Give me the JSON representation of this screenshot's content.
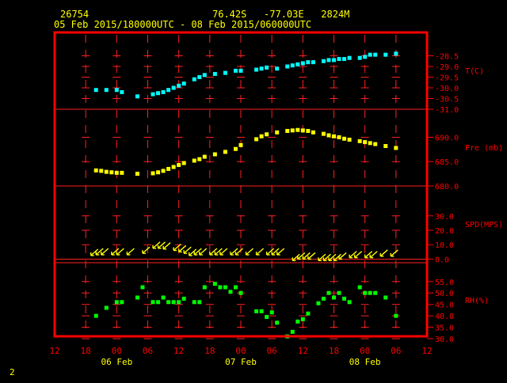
{
  "header": {
    "station": "26754",
    "coords": "76.42S   -77.03E   2824M",
    "period": "05 Feb 2015/180000UTC - 08 Feb 2015/060000UTC"
  },
  "page_number": "2",
  "colors": {
    "background": "#000000",
    "frame": "#ff0000",
    "grid": "#ff2020",
    "text": "#ffff00",
    "temperature": "#00ffff",
    "pressure": "#ffff00",
    "wind": "#ffff00",
    "humidity": "#00ff00"
  },
  "chart_data": {
    "type": "scatter",
    "x_unit": "hours since 05 Feb 2015 12 UTC",
    "x_ticks": [
      {
        "x": 0,
        "label": "12"
      },
      {
        "x": 6,
        "label": "18"
      },
      {
        "x": 12,
        "label": "00"
      },
      {
        "x": 18,
        "label": "06"
      },
      {
        "x": 24,
        "label": "12"
      },
      {
        "x": 30,
        "label": "18"
      },
      {
        "x": 36,
        "label": "00"
      },
      {
        "x": 42,
        "label": "06"
      },
      {
        "x": 48,
        "label": "12"
      },
      {
        "x": 54,
        "label": "18"
      },
      {
        "x": 60,
        "label": "00"
      },
      {
        "x": 66,
        "label": "06"
      },
      {
        "x": 72,
        "label": "12"
      }
    ],
    "day_labels": [
      {
        "x": 12,
        "label": "06 Feb"
      },
      {
        "x": 36,
        "label": "07 Feb"
      },
      {
        "x": 60,
        "label": "08 Feb"
      }
    ],
    "panels": [
      {
        "key": "temperature",
        "label": "T(C)",
        "ylim": [
          -31.0,
          -28.0
        ],
        "ticks": [
          -28.5,
          -29.0,
          -29.5,
          -30.0,
          -30.5,
          -31.0
        ],
        "tick_labels": [
          "-28.5",
          "-29.0",
          "-29.5",
          "-30.0",
          "-30.5",
          "-31.0"
        ],
        "x": [
          8,
          10,
          12,
          13,
          16,
          19,
          20,
          21,
          22,
          23,
          24,
          25,
          27,
          28,
          29,
          31,
          33,
          35,
          36,
          39,
          40,
          41,
          43,
          45,
          46,
          47,
          48,
          49,
          50,
          52,
          53,
          54,
          55,
          56,
          57,
          59,
          60,
          61,
          62,
          64,
          66
        ],
        "y": [
          -30.1,
          -30.1,
          -30.1,
          -30.2,
          -30.4,
          -30.3,
          -30.25,
          -30.2,
          -30.1,
          -30.0,
          -29.9,
          -29.8,
          -29.6,
          -29.5,
          -29.4,
          -29.35,
          -29.3,
          -29.2,
          -29.2,
          -29.15,
          -29.1,
          -29.05,
          -29.1,
          -29.0,
          -28.95,
          -28.9,
          -28.85,
          -28.8,
          -28.8,
          -28.75,
          -28.7,
          -28.7,
          -28.65,
          -28.65,
          -28.6,
          -28.6,
          -28.55,
          -28.45,
          -28.45,
          -28.45,
          -28.4
        ]
      },
      {
        "key": "pressure",
        "label": "Pre (mb)",
        "ylim": [
          680.0,
          693.0
        ],
        "ticks": [
          680.0,
          685.0,
          690.0
        ],
        "tick_labels": [
          "680.0",
          "685.0",
          "690.0"
        ],
        "x": [
          8,
          9,
          10,
          11,
          12,
          13,
          16,
          19,
          20,
          21,
          22,
          23,
          24,
          25,
          27,
          28,
          29,
          31,
          33,
          35,
          36,
          39,
          40,
          41,
          43,
          45,
          46,
          47,
          48,
          49,
          50,
          52,
          53,
          54,
          55,
          56,
          57,
          59,
          60,
          61,
          62,
          64,
          66
        ],
        "y": [
          683.2,
          683.1,
          682.9,
          682.8,
          682.7,
          682.7,
          682.5,
          682.6,
          682.8,
          683.1,
          683.5,
          683.9,
          684.3,
          684.7,
          685.2,
          685.5,
          686.0,
          686.5,
          687.0,
          687.6,
          688.4,
          689.6,
          690.2,
          690.6,
          691.0,
          691.3,
          691.4,
          691.5,
          691.4,
          691.3,
          691.0,
          690.7,
          690.4,
          690.2,
          690.0,
          689.7,
          689.5,
          689.2,
          689.0,
          688.8,
          688.6,
          688.2,
          687.8
        ]
      },
      {
        "key": "wind",
        "label": "SPD(MPS)",
        "ylim": [
          -2.5,
          37.0
        ],
        "ticks": [
          0.0,
          10.0,
          20.0,
          30.0
        ],
        "tick_labels": [
          "0.0",
          "10.0",
          "20.0",
          "30.0"
        ],
        "barbs": [
          {
            "x": 7,
            "y": 2.5
          },
          {
            "x": 8,
            "y": 3
          },
          {
            "x": 9,
            "y": 3
          },
          {
            "x": 11,
            "y": 3
          },
          {
            "x": 12,
            "y": 3
          },
          {
            "x": 14,
            "y": 3
          },
          {
            "x": 17,
            "y": 4
          },
          {
            "x": 19,
            "y": 7.5
          },
          {
            "x": 20,
            "y": 7.5
          },
          {
            "x": 21,
            "y": 7
          },
          {
            "x": 23,
            "y": 6
          },
          {
            "x": 24,
            "y": 5
          },
          {
            "x": 25,
            "y": 4
          },
          {
            "x": 26,
            "y": 2.5
          },
          {
            "x": 27,
            "y": 3
          },
          {
            "x": 28,
            "y": 3
          },
          {
            "x": 30,
            "y": 3
          },
          {
            "x": 31,
            "y": 3
          },
          {
            "x": 32,
            "y": 3
          },
          {
            "x": 34,
            "y": 3
          },
          {
            "x": 35,
            "y": 3
          },
          {
            "x": 37,
            "y": 3
          },
          {
            "x": 39,
            "y": 3
          },
          {
            "x": 41,
            "y": 3
          },
          {
            "x": 42,
            "y": 3
          },
          {
            "x": 43,
            "y": 3
          },
          {
            "x": 46,
            "y": -1
          },
          {
            "x": 47,
            "y": 0
          },
          {
            "x": 48,
            "y": 0
          },
          {
            "x": 49,
            "y": 0
          },
          {
            "x": 51,
            "y": -1
          },
          {
            "x": 52,
            "y": -1
          },
          {
            "x": 53,
            "y": -1
          },
          {
            "x": 54,
            "y": -1
          },
          {
            "x": 55,
            "y": 0
          },
          {
            "x": 57,
            "y": 1
          },
          {
            "x": 58,
            "y": 1
          },
          {
            "x": 60,
            "y": 1
          },
          {
            "x": 61,
            "y": 1
          },
          {
            "x": 63,
            "y": 2
          },
          {
            "x": 65,
            "y": 2
          }
        ]
      },
      {
        "key": "humidity",
        "label": "RH(%)",
        "ylim": [
          30.0,
          57.0
        ],
        "ticks": [
          30.0,
          35.0,
          40.0,
          45.0,
          50.0,
          55.0
        ],
        "tick_labels": [
          "30.0",
          "35.0",
          "40.0",
          "45.0",
          "50.0",
          "55.0"
        ],
        "x": [
          8,
          10,
          12,
          13,
          16,
          17,
          19,
          20,
          21,
          22,
          23,
          24,
          25,
          27,
          28,
          29,
          31,
          32,
          33,
          34,
          35,
          36,
          39,
          40,
          41,
          42,
          43,
          45,
          46,
          47,
          48,
          49,
          51,
          52,
          53,
          54,
          55,
          56,
          57,
          59,
          60,
          61,
          62,
          64,
          66
        ],
        "y": [
          40,
          43.5,
          46,
          46,
          48,
          52.5,
          46,
          46,
          48,
          46,
          46,
          46,
          47.5,
          46,
          46,
          52.5,
          54,
          52.5,
          52.5,
          50.5,
          52.5,
          50,
          42,
          42,
          39.5,
          41.5,
          37,
          31,
          33,
          37.5,
          38.5,
          41,
          45.5,
          47.5,
          50,
          48,
          50,
          47.5,
          46,
          52.5,
          50,
          50,
          50,
          48,
          40
        ]
      }
    ]
  }
}
